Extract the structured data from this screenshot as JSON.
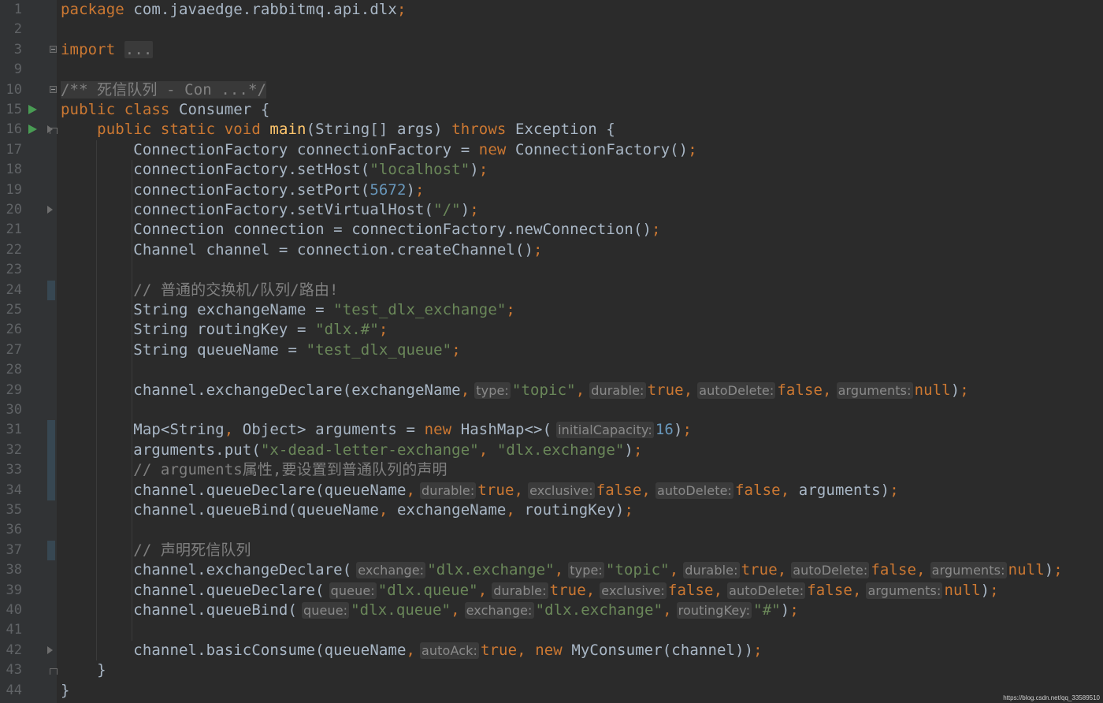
{
  "editor": {
    "language": "Java",
    "background_color": "#2b2b2b",
    "gutter_color": "#313335",
    "line_numbers": [
      "1",
      "2",
      "3",
      "9",
      "10",
      "15",
      "16",
      "17",
      "18",
      "19",
      "20",
      "21",
      "22",
      "23",
      "24",
      "25",
      "26",
      "27",
      "28",
      "29",
      "30",
      "31",
      "32",
      "33",
      "34",
      "35",
      "36",
      "37",
      "38",
      "39",
      "40",
      "41",
      "42",
      "43",
      "44"
    ],
    "run_icon_lines": [
      "15",
      "16"
    ],
    "lines": [
      [
        {
          "t": "package ",
          "c": "kw"
        },
        {
          "t": "com.javaedge.rabbitmq.api.dlx"
        },
        {
          "t": ";",
          "c": "kw"
        }
      ],
      [],
      [
        {
          "t": "import ",
          "c": "kw"
        },
        {
          "t": "...",
          "c": "fold"
        }
      ],
      [],
      [
        {
          "t": "/** 死信队列 - Con ...*/",
          "c": "doc-fold"
        }
      ],
      [
        {
          "t": "public class ",
          "c": "kw"
        },
        {
          "t": "Consumer {"
        }
      ],
      [
        {
          "t": "    "
        },
        {
          "t": "public static void ",
          "c": "kw"
        },
        {
          "t": "main",
          "c": "fn"
        },
        {
          "t": "(String[] args) "
        },
        {
          "t": "throws ",
          "c": "kw"
        },
        {
          "t": "Exception {"
        }
      ],
      [
        {
          "t": "        ConnectionFactory connectionFactory = "
        },
        {
          "t": "new ",
          "c": "kw"
        },
        {
          "t": "ConnectionFactory()"
        },
        {
          "t": ";",
          "c": "kw"
        }
      ],
      [
        {
          "t": "        connectionFactory.setHost("
        },
        {
          "t": "\"localhost\"",
          "c": "str"
        },
        {
          "t": ")"
        },
        {
          "t": ";",
          "c": "kw"
        }
      ],
      [
        {
          "t": "        connectionFactory.setPort("
        },
        {
          "t": "5672",
          "c": "num"
        },
        {
          "t": ")"
        },
        {
          "t": ";",
          "c": "kw"
        }
      ],
      [
        {
          "t": "        connectionFactory.setVirtualHost("
        },
        {
          "t": "\"/\"",
          "c": "str"
        },
        {
          "t": ")"
        },
        {
          "t": ";",
          "c": "kw"
        }
      ],
      [
        {
          "t": "        Connection connection = connectionFactory.newConnection()"
        },
        {
          "t": ";",
          "c": "kw"
        }
      ],
      [
        {
          "t": "        Channel channel = connection.createChannel()"
        },
        {
          "t": ";",
          "c": "kw"
        }
      ],
      [],
      [
        {
          "t": "        // 普通的交换机/队列/路由!",
          "c": "cmt"
        }
      ],
      [
        {
          "t": "        String exchangeName = "
        },
        {
          "t": "\"test_dlx_exchange\"",
          "c": "str"
        },
        {
          "t": ";",
          "c": "kw"
        }
      ],
      [
        {
          "t": "        String routingKey = "
        },
        {
          "t": "\"dlx.#\"",
          "c": "str"
        },
        {
          "t": ";",
          "c": "kw"
        }
      ],
      [
        {
          "t": "        String queueName = "
        },
        {
          "t": "\"test_dlx_queue\"",
          "c": "str"
        },
        {
          "t": ";",
          "c": "kw"
        }
      ],
      [],
      [
        {
          "t": "        channel.exchangeDeclare(exchangeName"
        },
        {
          "t": ",",
          "c": "kw"
        },
        {
          "t": "type:",
          "c": "hint"
        },
        {
          "t": "\"topic\"",
          "c": "str"
        },
        {
          "t": ",",
          "c": "kw"
        },
        {
          "t": "durable:",
          "c": "hint"
        },
        {
          "t": "true",
          "c": "kw"
        },
        {
          "t": ",",
          "c": "kw"
        },
        {
          "t": "autoDelete:",
          "c": "hint"
        },
        {
          "t": "false",
          "c": "kw"
        },
        {
          "t": ",",
          "c": "kw"
        },
        {
          "t": "arguments:",
          "c": "hint"
        },
        {
          "t": "null",
          "c": "kw"
        },
        {
          "t": ")"
        },
        {
          "t": ";",
          "c": "kw"
        }
      ],
      [],
      [
        {
          "t": "        Map<String"
        },
        {
          "t": ", ",
          "c": "kw"
        },
        {
          "t": "Object> arguments = "
        },
        {
          "t": "new ",
          "c": "kw"
        },
        {
          "t": "HashMap<>("
        },
        {
          "t": "initialCapacity:",
          "c": "hint"
        },
        {
          "t": "16",
          "c": "num"
        },
        {
          "t": ")"
        },
        {
          "t": ";",
          "c": "kw"
        }
      ],
      [
        {
          "t": "        arguments.put("
        },
        {
          "t": "\"x-dead-letter-exchange\"",
          "c": "str"
        },
        {
          "t": ", ",
          "c": "kw"
        },
        {
          "t": "\"dlx.exchange\"",
          "c": "str"
        },
        {
          "t": ")"
        },
        {
          "t": ";",
          "c": "kw"
        }
      ],
      [
        {
          "t": "        // arguments属性,要设置到普通队列的声明",
          "c": "cmt"
        }
      ],
      [
        {
          "t": "        channel.queueDeclare(queueName"
        },
        {
          "t": ",",
          "c": "kw"
        },
        {
          "t": "durable:",
          "c": "hint"
        },
        {
          "t": "true",
          "c": "kw"
        },
        {
          "t": ",",
          "c": "kw"
        },
        {
          "t": "exclusive:",
          "c": "hint"
        },
        {
          "t": "false",
          "c": "kw"
        },
        {
          "t": ",",
          "c": "kw"
        },
        {
          "t": "autoDelete:",
          "c": "hint"
        },
        {
          "t": "false",
          "c": "kw"
        },
        {
          "t": ", ",
          "c": "kw"
        },
        {
          "t": "arguments)"
        },
        {
          "t": ";",
          "c": "kw"
        }
      ],
      [
        {
          "t": "        channel.queueBind(queueName"
        },
        {
          "t": ", ",
          "c": "kw"
        },
        {
          "t": "exchangeName"
        },
        {
          "t": ", ",
          "c": "kw"
        },
        {
          "t": "routingKey)"
        },
        {
          "t": ";",
          "c": "kw"
        }
      ],
      [],
      [
        {
          "t": "        // 声明死信队列",
          "c": "cmt"
        }
      ],
      [
        {
          "t": "        channel.exchangeDeclare("
        },
        {
          "t": "exchange:",
          "c": "hint"
        },
        {
          "t": "\"dlx.exchange\"",
          "c": "str"
        },
        {
          "t": ",",
          "c": "kw"
        },
        {
          "t": "type:",
          "c": "hint"
        },
        {
          "t": "\"topic\"",
          "c": "str"
        },
        {
          "t": ",",
          "c": "kw"
        },
        {
          "t": "durable:",
          "c": "hint"
        },
        {
          "t": "true",
          "c": "kw"
        },
        {
          "t": ",",
          "c": "kw"
        },
        {
          "t": "autoDelete:",
          "c": "hint"
        },
        {
          "t": "false",
          "c": "kw"
        },
        {
          "t": ",",
          "c": "kw"
        },
        {
          "t": "arguments:",
          "c": "hint"
        },
        {
          "t": "null",
          "c": "kw"
        },
        {
          "t": ")"
        },
        {
          "t": ";",
          "c": "kw"
        }
      ],
      [
        {
          "t": "        channel.queueDeclare("
        },
        {
          "t": "queue:",
          "c": "hint"
        },
        {
          "t": "\"dlx.queue\"",
          "c": "str"
        },
        {
          "t": ",",
          "c": "kw"
        },
        {
          "t": "durable:",
          "c": "hint"
        },
        {
          "t": "true",
          "c": "kw"
        },
        {
          "t": ",",
          "c": "kw"
        },
        {
          "t": "exclusive:",
          "c": "hint"
        },
        {
          "t": "false",
          "c": "kw"
        },
        {
          "t": ",",
          "c": "kw"
        },
        {
          "t": "autoDelete:",
          "c": "hint"
        },
        {
          "t": "false",
          "c": "kw"
        },
        {
          "t": ",",
          "c": "kw"
        },
        {
          "t": "arguments:",
          "c": "hint"
        },
        {
          "t": "null",
          "c": "kw"
        },
        {
          "t": ")"
        },
        {
          "t": ";",
          "c": "kw"
        }
      ],
      [
        {
          "t": "        channel.queueBind("
        },
        {
          "t": "queue:",
          "c": "hint"
        },
        {
          "t": "\"dlx.queue\"",
          "c": "str"
        },
        {
          "t": ",",
          "c": "kw"
        },
        {
          "t": "exchange:",
          "c": "hint"
        },
        {
          "t": "\"dlx.exchange\"",
          "c": "str"
        },
        {
          "t": ",",
          "c": "kw"
        },
        {
          "t": "routingKey:",
          "c": "hint"
        },
        {
          "t": "\"#\"",
          "c": "str"
        },
        {
          "t": ")"
        },
        {
          "t": ";",
          "c": "kw"
        }
      ],
      [],
      [
        {
          "t": "        channel.basicConsume(queueName"
        },
        {
          "t": ",",
          "c": "kw"
        },
        {
          "t": "autoAck:",
          "c": "hint"
        },
        {
          "t": "true",
          "c": "kw"
        },
        {
          "t": ", ",
          "c": "kw"
        },
        {
          "t": "new ",
          "c": "kw"
        },
        {
          "t": "MyConsumer(channel))"
        },
        {
          "t": ";",
          "c": "kw"
        }
      ],
      [
        {
          "t": "    }"
        }
      ],
      [
        {
          "t": "}"
        }
      ]
    ]
  },
  "colors": {
    "keyword": "#cc7832",
    "string": "#6a8759",
    "number": "#6897bb",
    "comment": "#808080",
    "function": "#ffc66d",
    "text": "#a9b7c6",
    "run_icon": "#499c54"
  },
  "icons": {
    "run": "run-gutter-icon",
    "fold": "fold-toggle-icon",
    "fold_arrow": "fold-arrow-icon"
  },
  "watermark": "https://blog.csdn.net/qq_33589510"
}
